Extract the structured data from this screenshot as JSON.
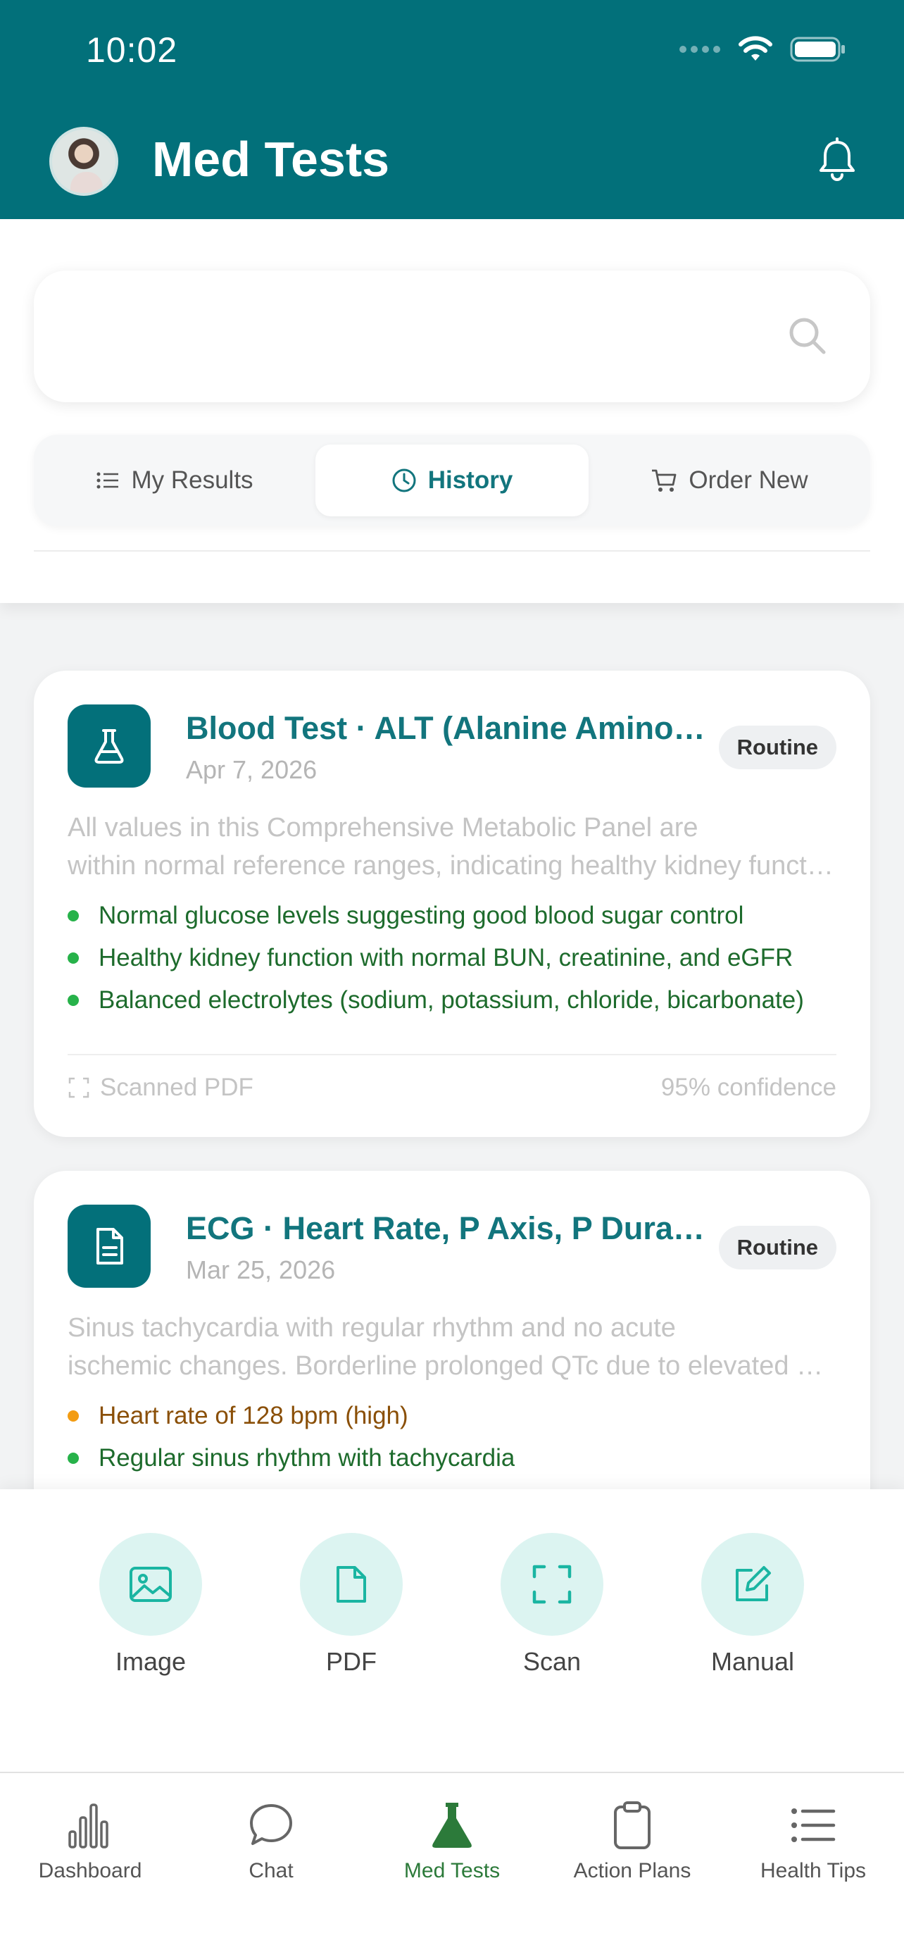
{
  "status_bar": {
    "time": "10:02"
  },
  "header": {
    "title": "Med Tests"
  },
  "search": {
    "placeholder": ""
  },
  "tabs": [
    {
      "label": "My Results",
      "icon": "list-icon",
      "active": false
    },
    {
      "label": "History",
      "icon": "clock-icon",
      "active": true
    },
    {
      "label": "Order New",
      "icon": "cart-icon",
      "active": false
    }
  ],
  "cards": [
    {
      "title": "Blood Test · ALT (Alanine Aminotransferase)",
      "date": "Apr 7, 2026",
      "badge": "Routine",
      "summary_line1": "All values in this Comprehensive Metabolic Panel are",
      "summary_line2": "within normal reference ranges, indicating healthy kidney function",
      "points": [
        {
          "text": "Normal glucose levels suggesting good blood sugar control",
          "status": "normal"
        },
        {
          "text": "Healthy kidney function with normal BUN, creatinine, and eGFR",
          "status": "normal"
        },
        {
          "text": "Balanced electrolytes (sodium, potassium, chloride, bicarbonate)",
          "status": "normal"
        }
      ],
      "source": "Scanned PDF",
      "confidence": "95% confidence"
    },
    {
      "title": "ECG · Heart Rate, P Axis, P Duration",
      "date": "Mar 25, 2026",
      "badge": "Routine",
      "summary_line1": "Sinus tachycardia with regular rhythm and no acute",
      "summary_line2": "ischemic changes. Borderline prolonged QTc due to elevated heart rate",
      "points": [
        {
          "text": "Heart rate of 128 bpm (high)",
          "status": "warning"
        },
        {
          "text": "Regular sinus rhythm with tachycardia",
          "status": "normal"
        }
      ]
    }
  ],
  "upload_options": [
    {
      "label": "Image",
      "icon": "image-icon"
    },
    {
      "label": "PDF",
      "icon": "pdf-file-icon"
    },
    {
      "label": "Scan",
      "icon": "scan-icon"
    },
    {
      "label": "Manual",
      "icon": "edit-icon"
    }
  ],
  "bottom_nav": [
    {
      "label": "Dashboard",
      "icon": "bar-chart-icon",
      "active": false
    },
    {
      "label": "Chat",
      "icon": "chat-bubble-icon",
      "active": false
    },
    {
      "label": "Med Tests",
      "icon": "flask-icon",
      "active": true
    },
    {
      "label": "Action Plans",
      "icon": "clipboard-icon",
      "active": false
    },
    {
      "label": "Health Tips",
      "icon": "list-icon",
      "active": false
    }
  ],
  "colors": {
    "header_bg": "#02707a",
    "accent_teal": "#12757d",
    "active_nav_green": "#2c7a3a",
    "normal_dot": "#27b24a",
    "warning_dot": "#f39c12",
    "upload_circle_bg": "#dcf4f1"
  }
}
